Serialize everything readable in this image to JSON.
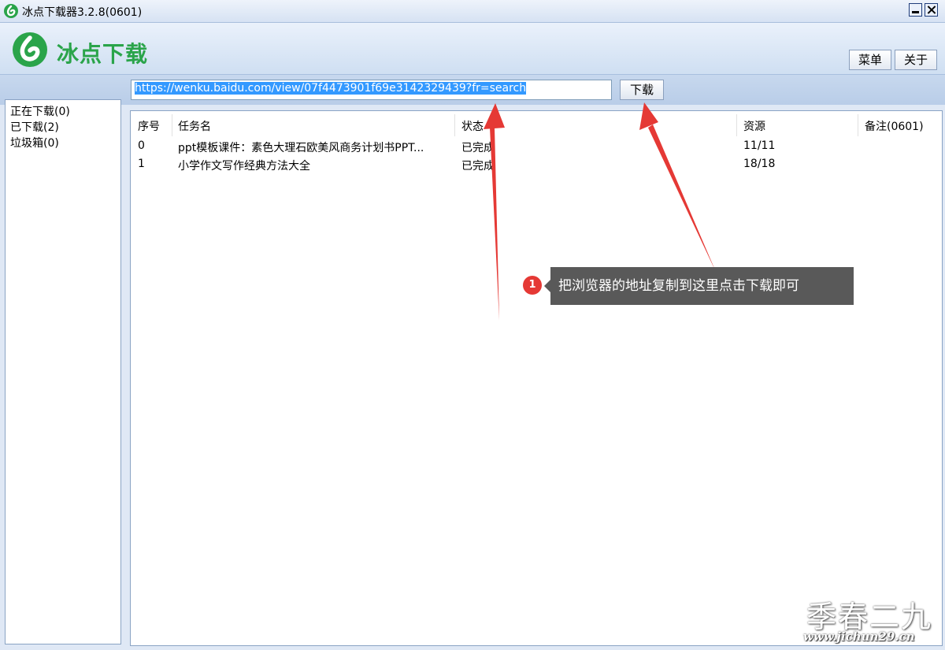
{
  "window": {
    "title": "冰点下载器3.2.8(0601)",
    "brand_color": "#2aa44a"
  },
  "header": {
    "logo_text": "冰点下载",
    "menu_label": "菜单",
    "about_label": "关于"
  },
  "url_bar": {
    "value": "https://wenku.baidu.com/view/07f4473901f69e3142329439?fr=search",
    "download_label": "下载"
  },
  "sidebar": {
    "items": [
      {
        "label": "正在下载(0)"
      },
      {
        "label": "已下载(2)"
      },
      {
        "label": "垃圾箱(0)"
      }
    ]
  },
  "table": {
    "columns": [
      "序号",
      "任务名",
      "状态",
      "资源",
      "备注(0601)"
    ],
    "rows": [
      {
        "index": "0",
        "name": "ppt模板课件：素色大理石欧美风商务计划书PPT...",
        "status": "已完成",
        "resource": "11/11",
        "note": ""
      },
      {
        "index": "1",
        "name": "小学作文写作经典方法大全",
        "status": "已完成",
        "resource": "18/18",
        "note": ""
      }
    ]
  },
  "annotation": {
    "step": "1",
    "text": "把浏览器的地址复制到这里点击下载即可",
    "arrow_color": "#e53935"
  },
  "watermark": {
    "big": "季春二九",
    "small": "www.jichun29.cn"
  }
}
